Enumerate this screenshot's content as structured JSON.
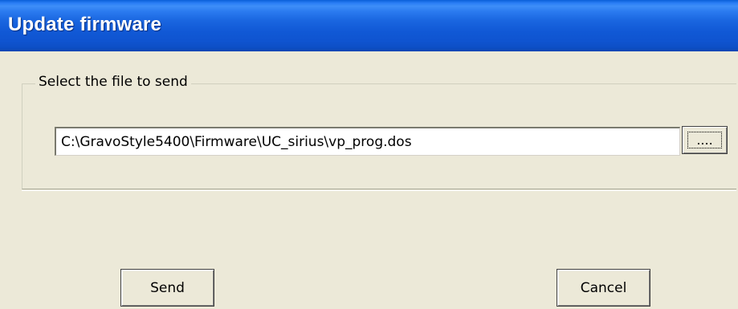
{
  "window": {
    "title": "Update firmware"
  },
  "file_group": {
    "legend": "Select the file to send",
    "path_value": "C:\\GravoStyle5400\\Firmware\\UC_sirius\\vp_prog.dos",
    "browse_label": "...."
  },
  "actions": {
    "send_label": "Send",
    "cancel_label": "Cancel"
  },
  "colors": {
    "titlebar": "#0d4fc6",
    "title_text": "#ffffff",
    "dialog_background": "#ece9d8",
    "input_background": "#ffffff"
  }
}
